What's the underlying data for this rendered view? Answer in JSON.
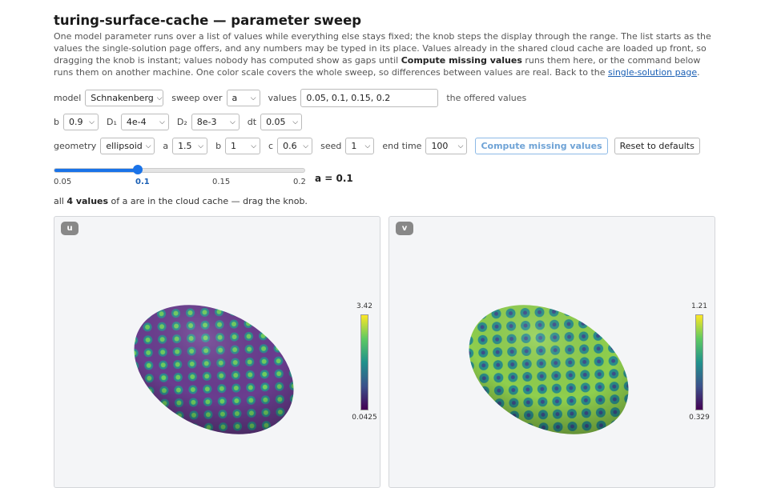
{
  "page": {
    "title": "turing-surface-cache — parameter sweep",
    "desc_1": "One model parameter runs over a list of values while everything else stays fixed; the knob steps the display through the range. The list starts as the values the single-solution page offers, and any numbers may be typed in its place. Values already in the shared cloud cache are loaded up front, so dragging the knob is instant; values nobody has computed show as gaps until ",
    "desc_bold": "Compute missing values",
    "desc_2": " runs them here, or the command below runs them on another machine. One color scale covers the whole sweep, so differences between values are real. Back to the ",
    "desc_link": "single-solution page",
    "desc_end": "."
  },
  "row1": {
    "model_label": "model",
    "model_value": "Schnakenberg",
    "sweep_label": "sweep over",
    "sweep_value": "a",
    "values_label": "values",
    "values_value": "0.05, 0.1, 0.15, 0.2",
    "offered_label": "the offered values"
  },
  "row2": {
    "b_label": "b",
    "b_value": "0.9",
    "d1_label": "D₁",
    "d1_value": "4e-4",
    "d2_label": "D₂",
    "d2_value": "8e-3",
    "dt_label": "dt",
    "dt_value": "0.05"
  },
  "row3": {
    "geometry_label": "geometry",
    "geometry_value": "ellipsoid",
    "a_label": "a",
    "a_value": "1.5",
    "b_label": "b",
    "b_value": "1",
    "c_label": "c",
    "c_value": "0.6",
    "seed_label": "seed",
    "seed_value": "1",
    "end_label": "end time",
    "end_value": "100",
    "compute_label": "Compute missing values",
    "reset_label": "Reset to defaults"
  },
  "slider": {
    "ticks": [
      "0.05",
      "0.1",
      "0.15",
      "0.2"
    ],
    "position_fraction": 0.333,
    "readout": "a = 0.1",
    "accent": "#1a73e8"
  },
  "status": {
    "pre": "all ",
    "bold": "4 values",
    "post": " of a are in the cloud cache — drag the knob."
  },
  "panels": {
    "u": {
      "badge": "u",
      "max": "3.42",
      "min": "0.0425"
    },
    "v": {
      "badge": "v",
      "max": "1.21",
      "min": "0.329"
    }
  },
  "colormap": [
    "#440154",
    "#3b528b",
    "#21918c",
    "#5ec962",
    "#fde725"
  ]
}
